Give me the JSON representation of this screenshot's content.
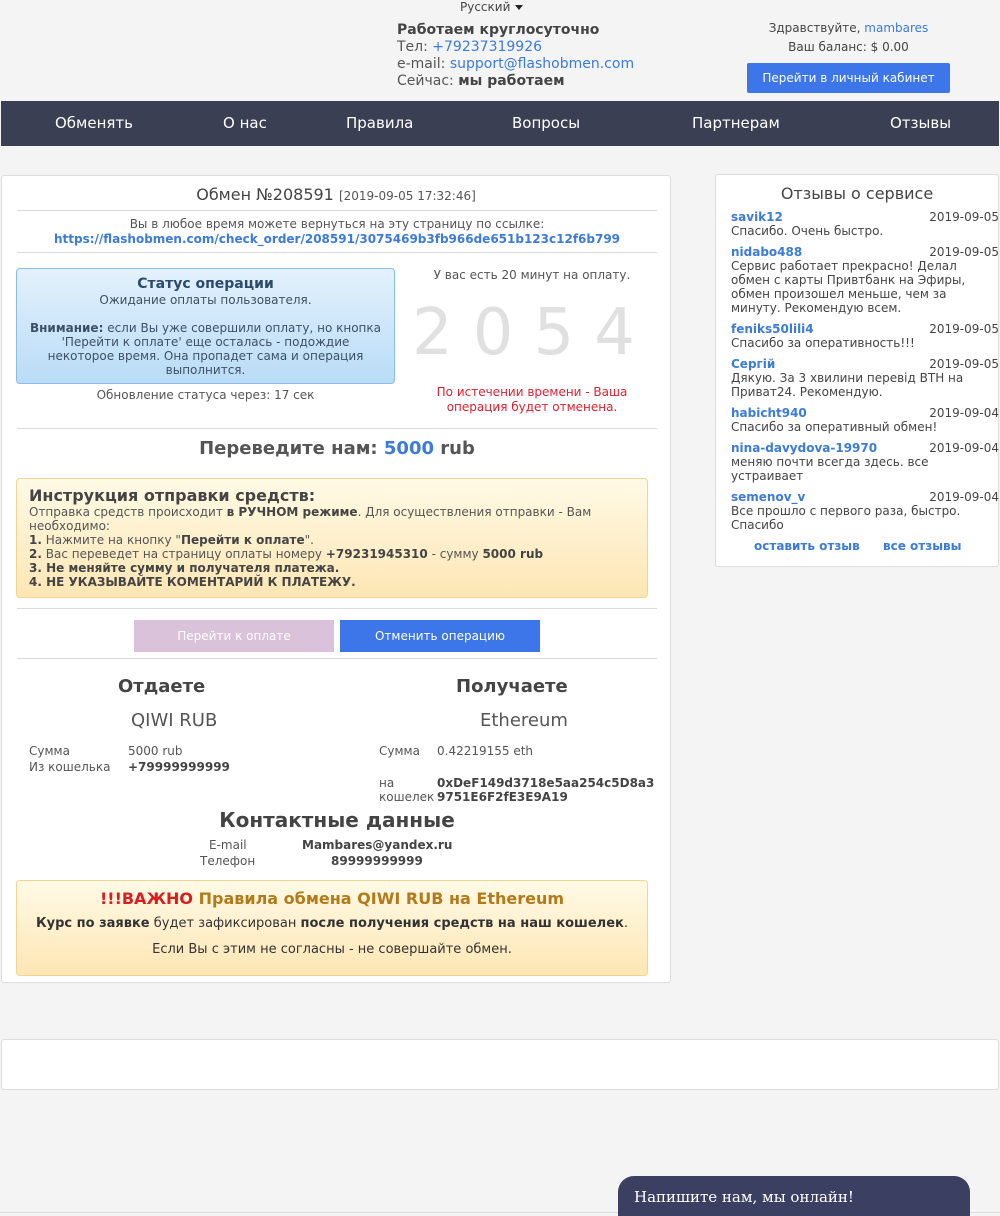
{
  "header": {
    "language": "Русский",
    "working_hours": "Работаем круглосуточно",
    "phone_label": "Тел:",
    "phone": "+79237319926",
    "email_label": "e-mail:",
    "email": "support@flashobmen.com",
    "now_label": "Сейчас:",
    "now_status": "мы работаем",
    "greeting": "Здравствуйте,",
    "username": "mambares",
    "balance": "Ваш баланс: $ 0.00",
    "cabinet_button": "Перейти в личный кабинет"
  },
  "nav": {
    "items": [
      "Обменять",
      "О нас",
      "Правила",
      "Вопросы",
      "Партнерам",
      "Отзывы"
    ]
  },
  "order": {
    "title": "Обмен №208591",
    "datetime": "[2019-09-05 17:32:46]",
    "return_text": "Вы в любое время можете вернуться на эту страницу по ссылке:",
    "return_link": "https://flashobmen.com/check_order/208591/3075469b3fb966de651b123c12f6b799",
    "status_title": "Статус операции",
    "status_text": "Ожидание оплаты пользователя.",
    "warning_label": "Внимание:",
    "warning_text": "если Вы уже совершили оплату, но кнопка 'Перейти к оплате' еще осталась - подождие некоторое время. Она пропадет сама и операция выполнится.",
    "update_text": "Обновление статуса через: 17 сек",
    "timer_note": "У вас есть 20 минут на оплату.",
    "timer_digits": [
      "2",
      "0",
      "5",
      "4"
    ],
    "timer_warning": "По истечении времени - Ваша операция будет отменена.",
    "transfer_label": "Переведите нам:",
    "transfer_amount": "5000",
    "transfer_currency": "rub"
  },
  "instructions": {
    "title": "Инструкция отправки средств:",
    "intro_a": "Отправка средств происходит ",
    "intro_b": "в РУЧНОМ режиме",
    "intro_c": ". Для осуществления отправки - Вам необходимо:",
    "s1_num": "1.",
    "s1_a": " Нажмите на кнопку \"",
    "s1_b": "Перейти к оплате",
    "s1_c": "\".",
    "s2_num": "2.",
    "s2_a": " Вас переведет на страницу оплаты номеру ",
    "s2_phone": "+79231945310",
    "s2_b": " - сумму ",
    "s2_sum": "5000 rub",
    "s3": "3. Не меняйте сумму и получателя платежа.",
    "s4": "4. НЕ УКАЗЫВАЙТЕ КОМЕНТАРИЙ К ПЛАТЕЖУ."
  },
  "buttons": {
    "pay": "Перейти к оплате",
    "cancel": "Отменить операцию"
  },
  "give": {
    "heading": "Отдаете",
    "currency": "QIWI RUB",
    "sum_label": "Сумма",
    "sum": "5000 rub",
    "wallet_label": "Из кошелька",
    "wallet": "+79999999999"
  },
  "get": {
    "heading": "Получаете",
    "currency": "Ethereum",
    "sum_label": "Сумма",
    "sum": "0.42219155 eth",
    "wallet_label_1": "на",
    "wallet_label_2": "кошелек",
    "wallet_line1": "0xDeF149d3718e5aa254c5D8a3",
    "wallet_line2": "9751E6F2fE3E9A19"
  },
  "contact": {
    "heading": "Контактные данные",
    "email_label": "E-mail",
    "email": "Mambares@yandex.ru",
    "phone_label": "Телефон",
    "phone": "89999999999"
  },
  "rules": {
    "important": "!!!ВАЖНО",
    "title": "Правила обмена QIWI RUB на Ethereum",
    "line1_a": "Курс по заявке",
    "line1_b": " будет зафиксирован ",
    "line1_c": "после получения средств на наш кошелек",
    "line1_d": ".",
    "line2": "Если Вы с этим не согласны - не совершайте обмен."
  },
  "reviews": {
    "title": "Отзывы о сервисе",
    "items": [
      {
        "name": "savik12",
        "date": "2019-09-05",
        "text": "Спасибо. Очень быстро."
      },
      {
        "name": "nidabo488",
        "date": "2019-09-05",
        "text": "Сервис работает прекрасно! Делал обмен с карты Привтбанк на Эфиры, обмен произошел меньше, чем за минуту. Рекомендую всем."
      },
      {
        "name": "feniks50lili4",
        "date": "2019-09-05",
        "text": "Спасибо за оперативность!!!"
      },
      {
        "name": "Сергій",
        "date": "2019-09-05",
        "text": "Дякую. За 3 хвилини перевід ВТН на Приват24. Рекомендую."
      },
      {
        "name": "habicht940",
        "date": "2019-09-04",
        "text": "Спасибо за оперативный обмен!"
      },
      {
        "name": "nina-davydova-19970",
        "date": "2019-09-04",
        "text": "меняю почти всегда здесь. все устраивает"
      },
      {
        "name": "semenov_v",
        "date": "2019-09-04",
        "text": "Все прошло с первого раза, быстро. Спасибо"
      }
    ],
    "leave_review": "оставить отзыв",
    "all_reviews": "все отзывы"
  },
  "chat": {
    "label": "Напишите нам, мы онлайн!"
  }
}
